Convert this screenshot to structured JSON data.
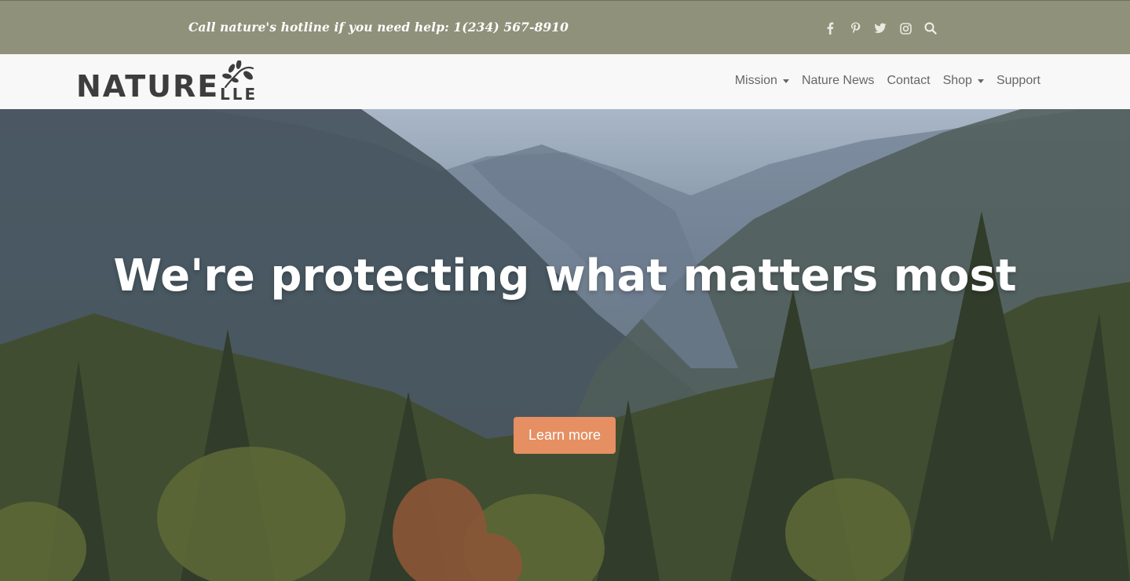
{
  "topbar": {
    "hotline": "Call nature's hotline if you need help: 1(234) 567-8910",
    "social_icons": [
      "facebook-icon",
      "pinterest-icon",
      "twitter-icon",
      "instagram-icon",
      "search-icon"
    ],
    "background": "#8f917a"
  },
  "navbar": {
    "logo": {
      "main": "NATURE",
      "suffix": "LLE"
    },
    "items": [
      {
        "label": "Mission",
        "dropdown": true
      },
      {
        "label": "Nature News",
        "dropdown": false
      },
      {
        "label": "Contact",
        "dropdown": false
      },
      {
        "label": "Shop",
        "dropdown": true
      },
      {
        "label": "Support",
        "dropdown": false
      }
    ]
  },
  "hero": {
    "headline": "We're protecting what matters most",
    "cta_label": "Learn more",
    "cta_color": "#e58f62"
  }
}
